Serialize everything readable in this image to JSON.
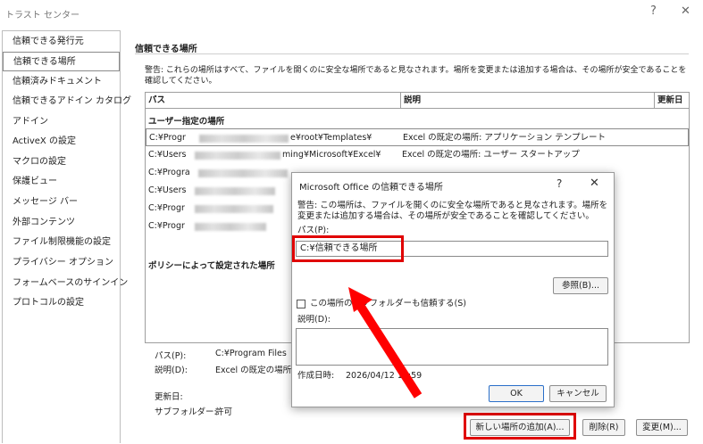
{
  "window": {
    "title": "トラスト センター",
    "help": "?",
    "close": "✕"
  },
  "sidebar": {
    "items": [
      {
        "label": "信頼できる発行元"
      },
      {
        "label": "信頼できる場所"
      },
      {
        "label": "信頼済みドキュメント"
      },
      {
        "label": "信頼できるアドイン カタログ"
      },
      {
        "label": "アドイン"
      },
      {
        "label": "ActiveX の設定"
      },
      {
        "label": "マクロの設定"
      },
      {
        "label": "保護ビュー"
      },
      {
        "label": "メッセージ バー"
      },
      {
        "label": "外部コンテンツ"
      },
      {
        "label": "ファイル制限機能の設定"
      },
      {
        "label": "プライバシー オプション"
      },
      {
        "label": "フォームベースのサインイン"
      },
      {
        "label": "プロトコルの設定"
      }
    ]
  },
  "main": {
    "title": "信頼できる場所",
    "warning": "警告: これらの場所はすべて、ファイルを開くのに安全な場所であると見なされます。場所を変更または追加する場合は、その場所が安全であることを確認してください。",
    "columns": {
      "path": "パス",
      "description": "説明",
      "modified": "更新日"
    },
    "user_group": "ユーザー指定の場所",
    "rows": [
      {
        "path_start": "C:¥Progr",
        "path_end": "e¥root¥Templates¥",
        "description": "Excel の既定の場所: アプリケーション テンプレート"
      },
      {
        "path_start": "C:¥Users",
        "path_end": "ming¥Microsoft¥Excel¥",
        "description": "Excel の既定の場所: ユーザー スタートアップ"
      },
      {
        "path_start": "C:¥Progra",
        "path_end": "",
        "description": ""
      },
      {
        "path_start": "C:¥Users",
        "path_end": "",
        "description": ""
      },
      {
        "path_start": "C:¥Progr",
        "path_end": "",
        "description": ""
      },
      {
        "path_start": "C:¥Progr",
        "path_end": "",
        "description": ""
      }
    ],
    "policy_group": "ポリシーによって設定された場所",
    "details": {
      "path_label": "パス(P):",
      "path_value": "C:¥Program Files",
      "desc_label": "説明(D):",
      "desc_value": "Excel の既定の場所",
      "date_label": "更新日:",
      "subfolder_label": "サブフォルダー:",
      "subfolder_value": "許可"
    },
    "buttons": {
      "add": "新しい場所の追加(A)...",
      "remove": "削除(R)",
      "modify": "変更(M)..."
    }
  },
  "dialog": {
    "title": "Microsoft Office の信頼できる場所",
    "help": "?",
    "close": "✕",
    "warning": "警告: この場所は、ファイルを開くのに安全な場所であると見なされます。場所を変更または追加する場合は、その場所が安全であることを確認してください。",
    "path_label": "パス(P):",
    "path_value": "C:¥信頼できる場所",
    "browse": "参照(B)...",
    "subfolder_check": "この場所のサブフォルダーも信頼する(S)",
    "desc_label": "説明(D):",
    "date_label": "作成日時:",
    "date_value": "2026/04/12 14:59",
    "ok": "OK",
    "cancel": "キャンセル"
  },
  "colors": {
    "highlight": "#e00000",
    "arrow": "#ff0000"
  }
}
